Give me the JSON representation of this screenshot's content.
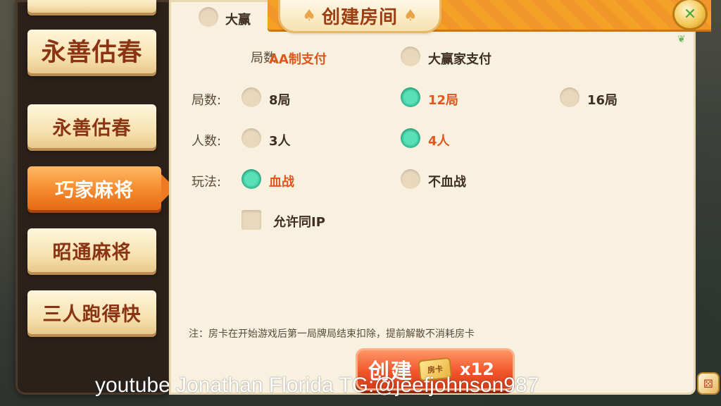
{
  "dialog": {
    "title": "创建房间",
    "help_icon": "close-help-icon"
  },
  "tabs": [
    {
      "label": "",
      "state": "partial"
    },
    {
      "label": "永善估春",
      "state": "stylized"
    },
    {
      "label": "永善估春",
      "state": "normal"
    },
    {
      "label": "巧家麻将",
      "state": "active"
    },
    {
      "label": "昭通麻将",
      "state": "normal"
    },
    {
      "label": "三人跑得快",
      "state": "normal"
    }
  ],
  "settings": {
    "partial_top_option": "大赢",
    "pay": {
      "label": "局数",
      "options": [
        "AA制支付",
        "大赢家支付"
      ],
      "selected": 0
    },
    "rounds": {
      "label": "局数:",
      "options": [
        "8局",
        "12局",
        "16局"
      ],
      "selected": 1
    },
    "players": {
      "label": "人数:",
      "options": [
        "3人",
        "4人"
      ],
      "selected": 1
    },
    "play": {
      "label": "玩法:",
      "options": [
        "血战",
        "不血战"
      ],
      "selected": 0
    },
    "same_ip": {
      "label": "允许同IP",
      "checked": false
    }
  },
  "note": "注：房卡在开始游戏后第一局牌局结束扣除，提前解散不消耗房卡",
  "create": {
    "label": "创建",
    "card_label": "房卡",
    "count": "x12"
  },
  "watermark": "youtube Jonathan Florida    TG:@jeefjohnson987",
  "colors": {
    "accent": "#f58a2c",
    "selected_text": "#e0561e",
    "radio_on": "#3ccf9f"
  }
}
